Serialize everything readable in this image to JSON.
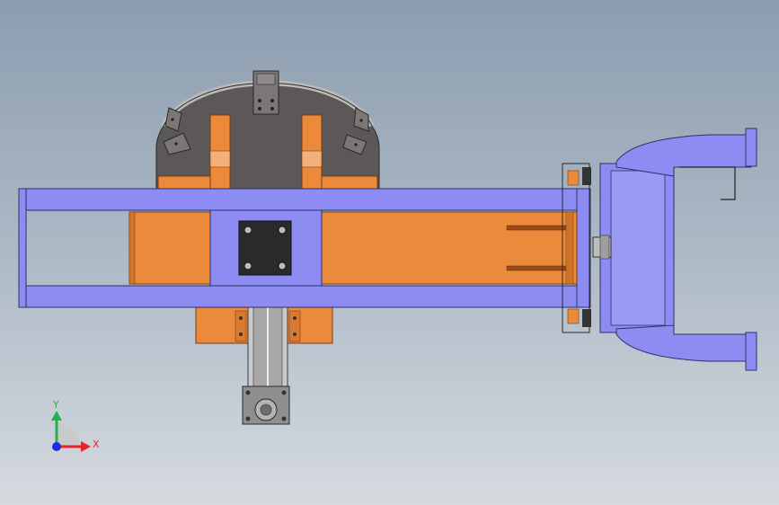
{
  "triad": {
    "x_label": "X",
    "y_label": "Y",
    "x_color": "#e8242a",
    "y_color": "#22b14c",
    "z_color": "#1c2ee0"
  },
  "colors": {
    "frame": "#8c8cf2",
    "frame_dark": "#3a3a7a",
    "orange": "#ec8a3c",
    "orange_dark": "#b35a1a",
    "turntable": "#5e5a59",
    "metal": "#8a8a8a",
    "bracket": "#7a7676"
  }
}
